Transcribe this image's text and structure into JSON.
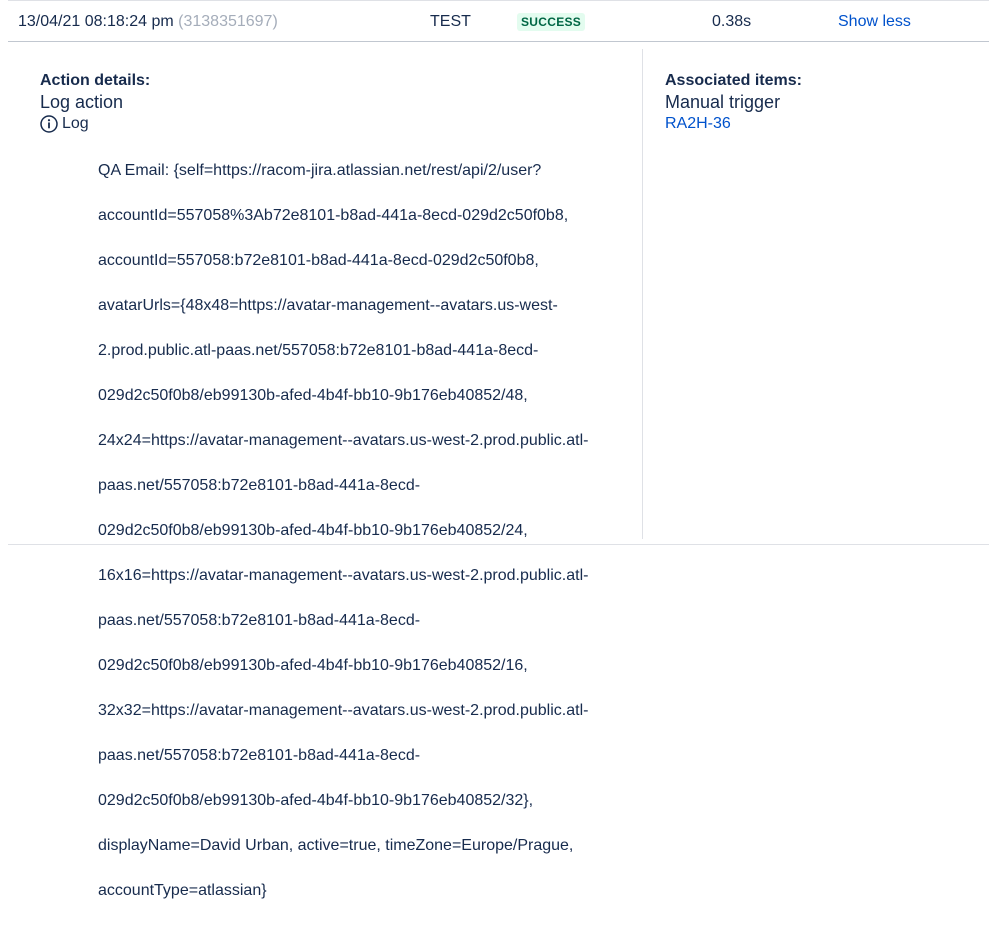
{
  "summary": {
    "timestamp": "13/04/21 08:18:24 pm",
    "execution_id": "(3138351697)",
    "rule_type": "TEST",
    "status": "SUCCESS",
    "duration": "0.38s",
    "toggle_label": "Show less"
  },
  "action_details": {
    "heading": "Action details:",
    "title": "Log action",
    "log_label": "Log",
    "log_icon": "info-circle-icon",
    "log_lines": [
      "QA Email: {self=https://racom-jira.atlassian.net/rest/api/2/user?",
      "accountId=557058%3Ab72e8101-b8ad-441a-8ecd-029d2c50f0b8,",
      "accountId=557058:b72e8101-b8ad-441a-8ecd-029d2c50f0b8,",
      "avatarUrls={48x48=https://avatar-management--avatars.us-west-",
      "2.prod.public.atl-paas.net/557058:b72e8101-b8ad-441a-8ecd-",
      "029d2c50f0b8/eb99130b-afed-4b4f-bb10-9b176eb40852/48,",
      "24x24=https://avatar-management--avatars.us-west-2.prod.public.atl-",
      "paas.net/557058:b72e8101-b8ad-441a-8ecd-",
      "029d2c50f0b8/eb99130b-afed-4b4f-bb10-9b176eb40852/24,",
      "16x16=https://avatar-management--avatars.us-west-2.prod.public.atl-",
      "paas.net/557058:b72e8101-b8ad-441a-8ecd-",
      "029d2c50f0b8/eb99130b-afed-4b4f-bb10-9b176eb40852/16,",
      "32x32=https://avatar-management--avatars.us-west-2.prod.public.atl-",
      "paas.net/557058:b72e8101-b8ad-441a-8ecd-",
      "029d2c50f0b8/eb99130b-afed-4b4f-bb10-9b176eb40852/32},",
      "displayName=David Urban, active=true, timeZone=Europe/Prague,",
      "accountType=atlassian}"
    ]
  },
  "associated_items": {
    "heading": "Associated items:",
    "title": "Manual trigger",
    "issue_key": "RA2H-36"
  },
  "colors": {
    "text": "#172b4d",
    "muted": "#a5adba",
    "link": "#0052cc",
    "success_text": "#006644",
    "success_bg": "#e3fcef",
    "border": "#dfe1e6"
  }
}
